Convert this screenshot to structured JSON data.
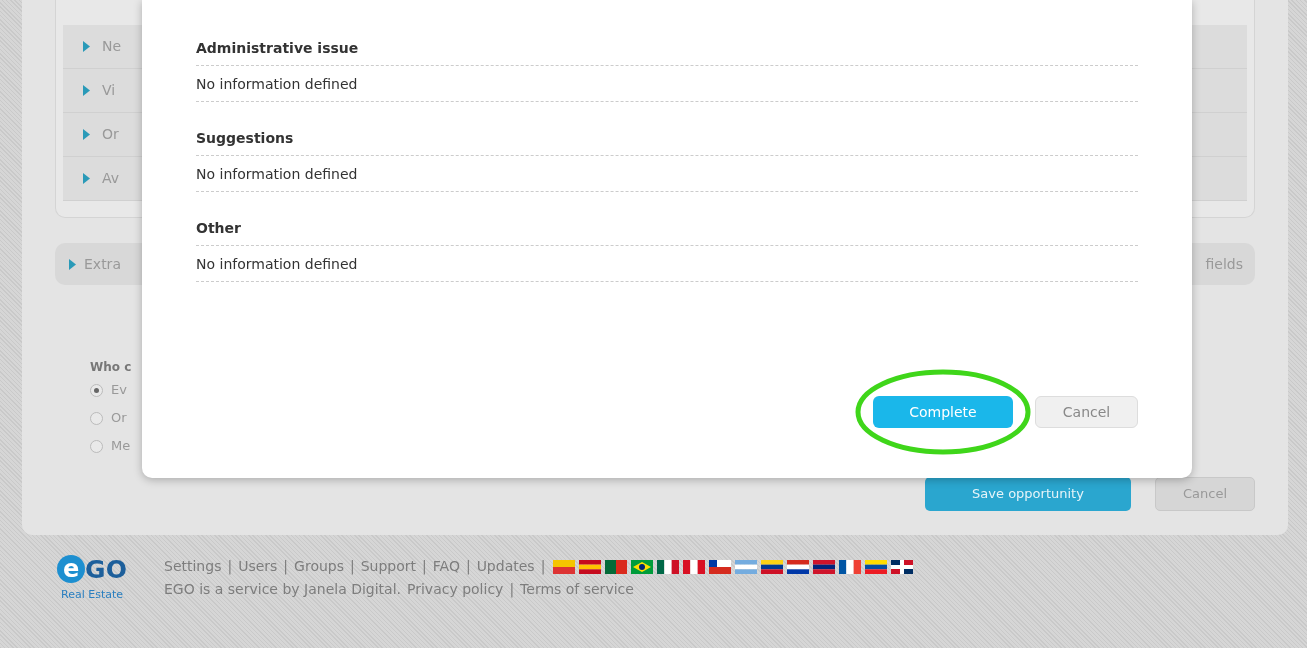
{
  "background_page": {
    "list_items": [
      {
        "label": "Ne"
      },
      {
        "label": "Vi"
      },
      {
        "label": "Or"
      },
      {
        "label": "Av"
      }
    ],
    "extra_section": {
      "label": "Extra",
      "right_label": "fields"
    },
    "visibility": {
      "title": "Who c",
      "options": [
        {
          "label": "Ev",
          "selected": true
        },
        {
          "label": "Or",
          "selected": false
        },
        {
          "label": "Me",
          "selected": false
        }
      ]
    },
    "buttons": [
      {
        "label": "Save opportunity",
        "kind": "primary"
      },
      {
        "label": "Cancel",
        "kind": "secondary"
      }
    ]
  },
  "dialog": {
    "sections": [
      {
        "title": "Administrative issue",
        "value": "No information defined"
      },
      {
        "title": "Suggestions",
        "value": "No information defined"
      },
      {
        "title": "Other",
        "value": "No information defined"
      }
    ],
    "buttons": [
      {
        "label": "Complete",
        "kind": "primary",
        "highlighted": true
      },
      {
        "label": "Cancel",
        "kind": "secondary",
        "highlighted": false
      }
    ]
  },
  "footer": {
    "logo": {
      "mark": "e",
      "text": "GO",
      "subtitle": "Real Estate"
    },
    "links": [
      "Settings",
      "Users",
      "Groups",
      "Support",
      "FAQ",
      "Updates"
    ],
    "separator": "|",
    "credit": "EGO is a service by Janela Digital.",
    "legal_links": [
      "Privacy policy",
      "Terms of service"
    ]
  }
}
